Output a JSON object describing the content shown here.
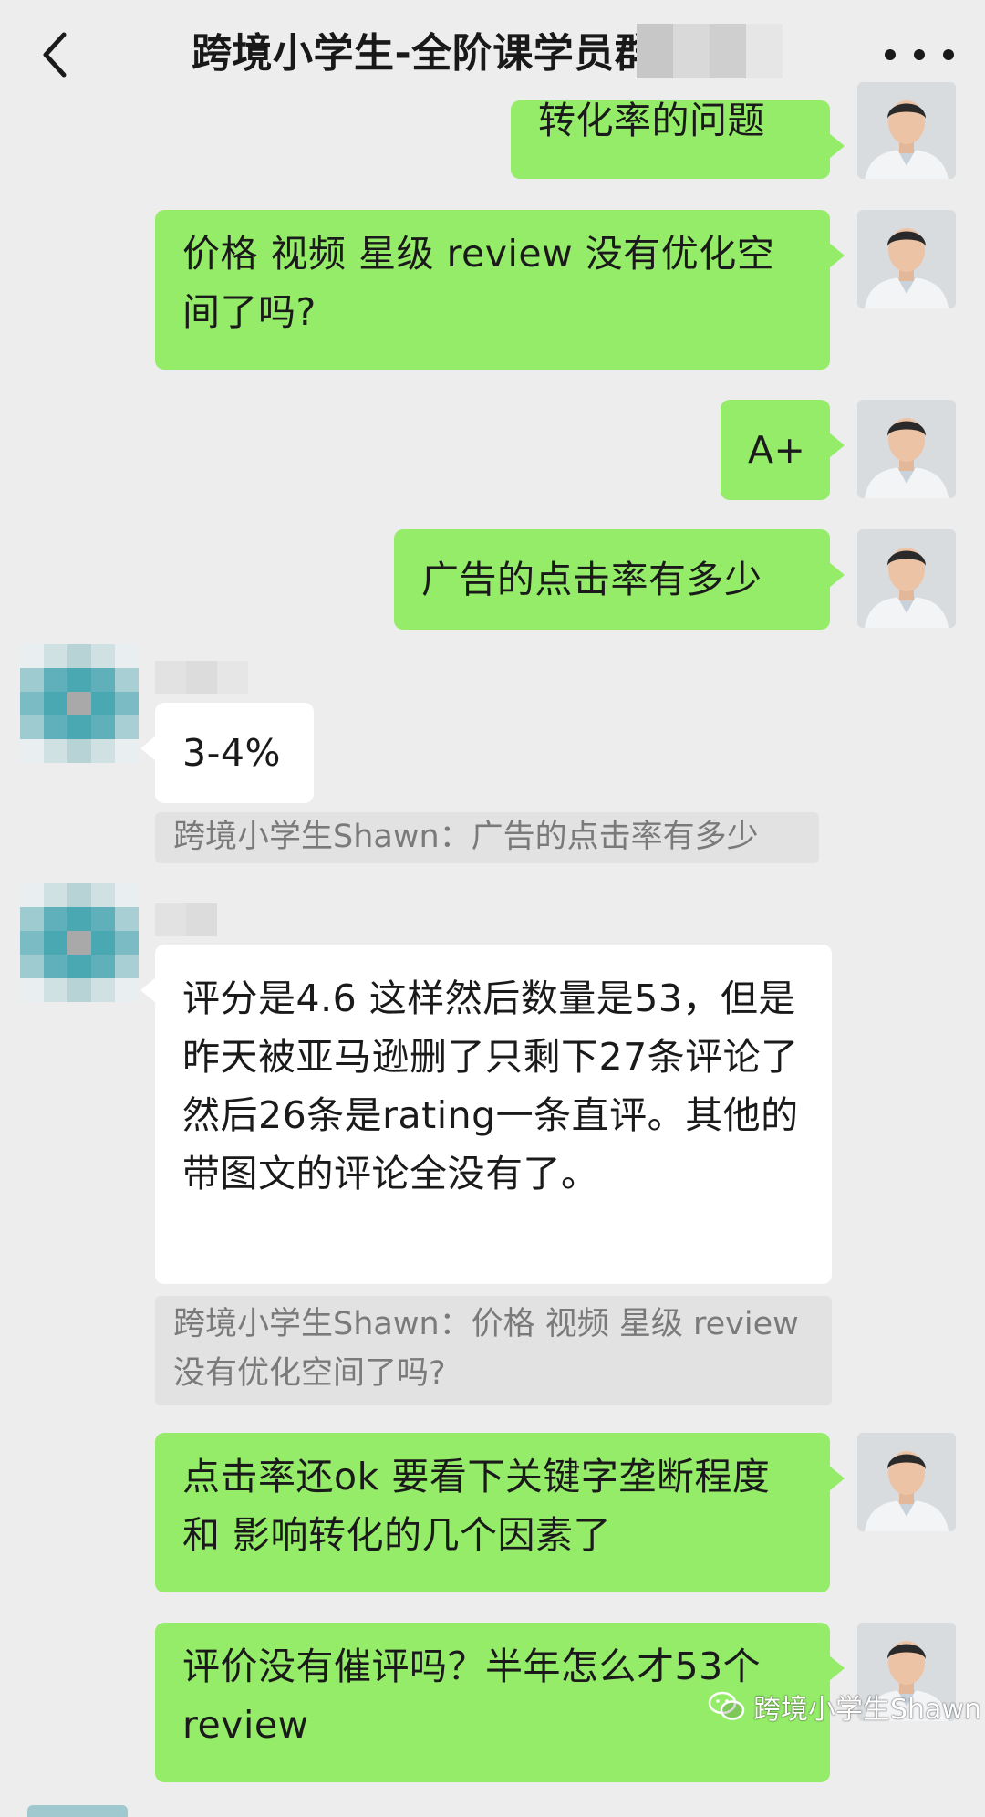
{
  "header": {
    "title": "跨境小学生-全阶课学员群"
  },
  "messages": [
    {
      "side": "right",
      "text": "转化率的问题"
    },
    {
      "side": "right",
      "text": "价格 视频 星级 review 没有优化空间了吗?"
    },
    {
      "side": "right",
      "text": "A+"
    },
    {
      "side": "right",
      "text": "广告的点击率有多少"
    },
    {
      "side": "left",
      "text": "3-4%",
      "quote": "跨境小学生Shawn：广告的点击率有多少"
    },
    {
      "side": "left",
      "text": "评分是4.6 这样然后数量是53，但是昨天被亚马逊删了只剩下27条评论了然后26条是rating一条直评。其他的带图文的评论全没有了。",
      "quote": "跨境小学生Shawn：价格 视频 星级 review 没有优化空间了吗?"
    },
    {
      "side": "right",
      "text": "点击率还ok 要看下关键字垄断程度和 影响转化的几个因素了"
    },
    {
      "side": "right",
      "text": "评价没有催评吗？半年怎么才53个review"
    }
  ],
  "watermark": {
    "text": "跨境小学生Shawn"
  },
  "colors": {
    "background": "#ededed",
    "bubble_mine": "#95ec69",
    "bubble_theirs": "#ffffff",
    "quote_bg": "#e2e2e2",
    "quote_text": "#7a7a7a"
  },
  "icons": [
    "chevron-left-icon",
    "more-dots-icon",
    "wechat-icon"
  ]
}
